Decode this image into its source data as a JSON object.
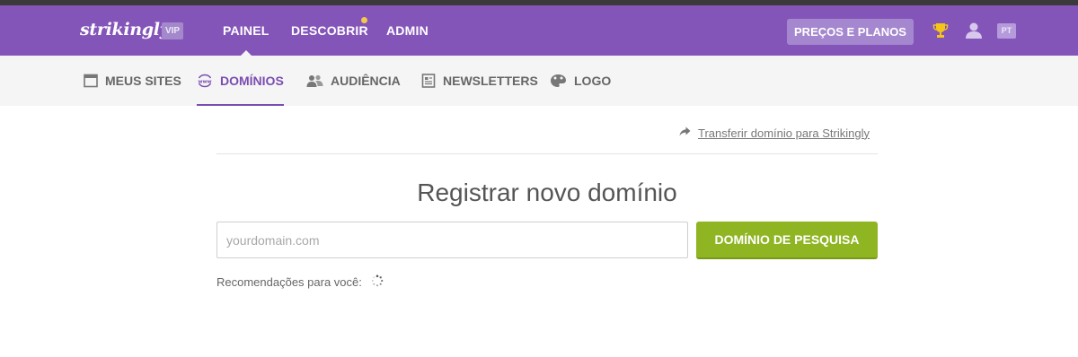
{
  "topbar": {
    "logo": "strikingly",
    "vip_badge": "VIP",
    "nav": [
      {
        "label": "PAINEL",
        "active": true
      },
      {
        "label": "DESCOBRIR",
        "notification_dot": true
      },
      {
        "label": "ADMIN"
      }
    ],
    "pricing_button": "PREÇOS E PLANOS",
    "language": "PT",
    "icons": [
      "trophy-icon",
      "user-icon"
    ]
  },
  "subnav": {
    "items": [
      {
        "label": "MEUS SITES",
        "icon": "browser-window-icon"
      },
      {
        "label": "DOMÍNIOS",
        "icon": "www-globe-icon",
        "active": true
      },
      {
        "label": "AUDIÊNCIA",
        "icon": "people-icon"
      },
      {
        "label": "NEWSLETTERS",
        "icon": "newsletter-icon"
      },
      {
        "label": "LOGO",
        "icon": "palette-icon"
      }
    ]
  },
  "main": {
    "transfer_link": "Transferir domínio para Strikingly",
    "heading": "Registrar novo domínio",
    "search_placeholder": "yourdomain.com",
    "search_value": "",
    "search_button": "DOMÍNIO DE PESQUISA",
    "recommendations_label": "Recomendações para você:"
  },
  "colors": {
    "topbar": "#8455b9",
    "accent": "#7a4db0",
    "search_button": "#8fb523",
    "subnav_bg": "#f5f5f5",
    "notification_dot": "#f2c94c"
  }
}
